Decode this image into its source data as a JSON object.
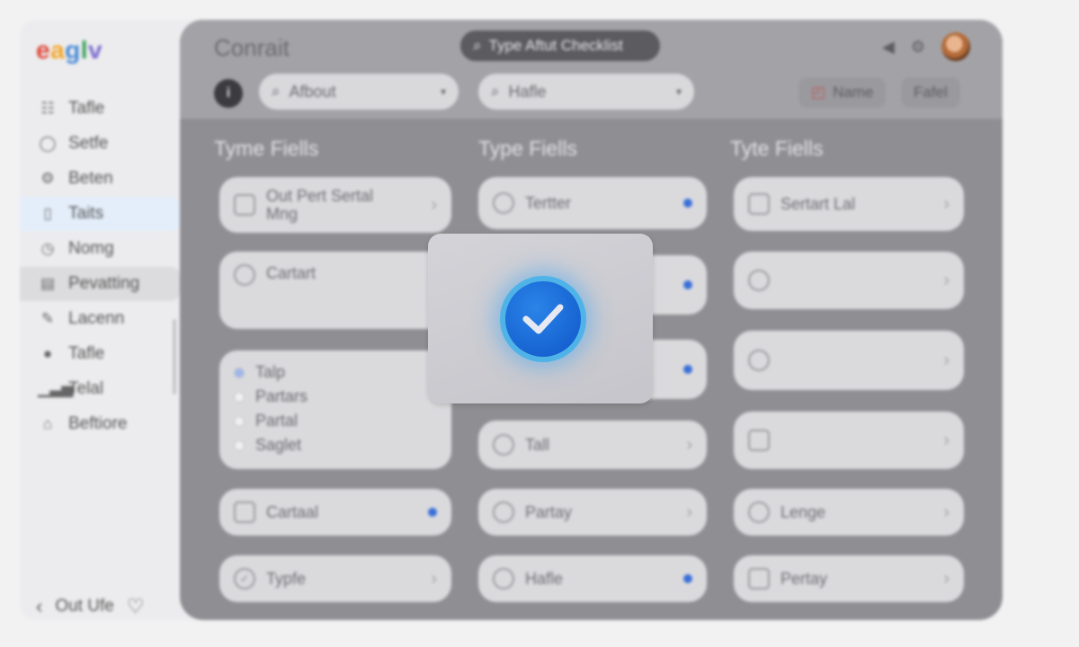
{
  "app": {
    "logo": [
      "e",
      "a",
      "g",
      "l",
      "v"
    ],
    "title": "Conrait"
  },
  "sidebar": {
    "items": [
      {
        "label": "Tafle",
        "icon": "list-icon"
      },
      {
        "label": "Setfe",
        "icon": "chat-icon"
      },
      {
        "label": "Beten",
        "icon": "gear-icon"
      },
      {
        "label": "Taits",
        "icon": "tablet-icon",
        "active": true
      },
      {
        "label": "Nomg",
        "icon": "timer-icon"
      },
      {
        "label": "Pevatting",
        "icon": "document-icon",
        "highlight": true
      },
      {
        "label": "Lacenn",
        "icon": "pencil-icon"
      },
      {
        "label": "Tafle",
        "icon": "microphone-icon"
      },
      {
        "label": "Telal",
        "icon": "bar-chart-icon"
      },
      {
        "label": "Beftiore",
        "icon": "building-icon"
      }
    ],
    "footer": {
      "label": "Out Ufe"
    }
  },
  "header": {
    "command_placeholder": "Type Aftut Checklist",
    "filter_1": "Afbout",
    "filter_2": "Hafle",
    "action_1": "Name",
    "action_2": "Fafel"
  },
  "columns": [
    {
      "title": "Tyme Fiells",
      "cards": [
        {
          "label": "Out Pert Sertal Mng",
          "icon": "square-icon",
          "trail": "chevron"
        },
        {
          "label": "Cartart",
          "icon": "circle-icon",
          "trail": "dots"
        },
        {
          "type": "radio",
          "options": [
            {
              "label": "Talp",
              "checked": true
            },
            {
              "label": "Partars",
              "checked": false
            },
            {
              "label": "Partal",
              "checked": false
            },
            {
              "label": "Saglet",
              "checked": false
            }
          ]
        },
        {
          "label": "Cartaal",
          "icon": "calendar-icon",
          "trail": "dot"
        },
        {
          "label": "Typfe",
          "icon": "check-icon",
          "trail": "chevron"
        }
      ]
    },
    {
      "title": "Type Fiells",
      "cards": [
        {
          "label": "Tertter",
          "icon": "circle-icon",
          "trail": "dot"
        },
        {
          "label": "",
          "icon": "circle-icon",
          "trail": "dot"
        },
        {
          "label": "",
          "icon": "circle-icon",
          "trail": "dot"
        },
        {
          "label": "Tall",
          "icon": "circle-icon",
          "trail": "chevron"
        },
        {
          "label": "Partay",
          "icon": "circle-icon",
          "trail": "chevron"
        },
        {
          "label": "Hafle",
          "icon": "circle-icon",
          "trail": "dot"
        }
      ]
    },
    {
      "title": "Tyte Fiells",
      "cards": [
        {
          "label": "Sertart Lal",
          "icon": "grid-icon",
          "trail": "chevron"
        },
        {
          "label": "",
          "icon": "cloud-icon",
          "trail": "chevron"
        },
        {
          "label": "",
          "icon": "search-icon",
          "trail": "chevron"
        },
        {
          "label": "",
          "icon": "lock-icon",
          "trail": "chevron"
        },
        {
          "label": "Lenge",
          "icon": "heart-icon",
          "trail": "chevron"
        },
        {
          "label": "Pertay",
          "icon": "square-icon",
          "trail": "chevron"
        }
      ]
    }
  ],
  "overlay": {
    "icon": "checkmark-icon",
    "accent": "#1565d8"
  }
}
